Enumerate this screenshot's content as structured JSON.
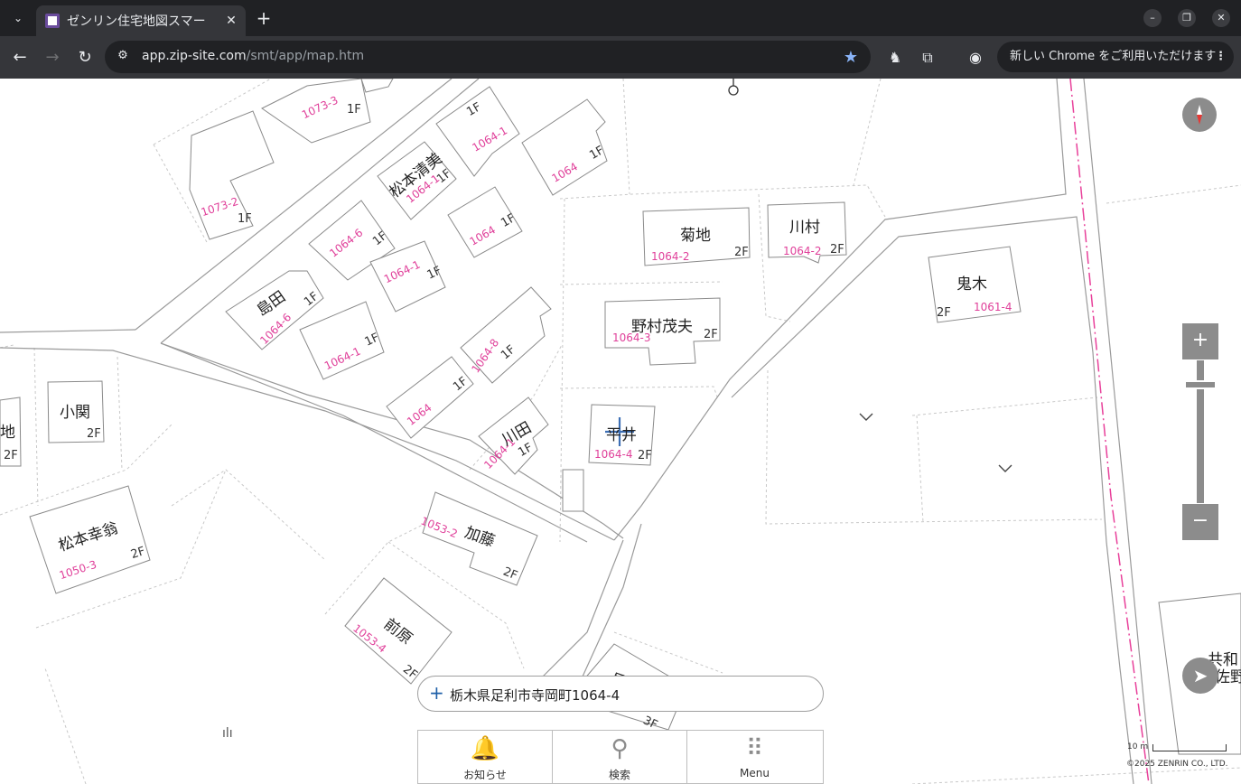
{
  "browser": {
    "tab_title": "ゼンリン住宅地図スマー",
    "url_host": "app.zip-site.com",
    "url_path": "/smt/app/map.htm",
    "update_label": "新しい Chrome をご利用いただけます"
  },
  "map": {
    "address": "栃木県足利市寺岡町1064-4",
    "labels": [
      {
        "text": "1073-3",
        "kind": "num"
      },
      {
        "text": "1F",
        "kind": "fl"
      },
      {
        "text": "1073-2",
        "kind": "num"
      },
      {
        "text": "1F",
        "kind": "fl"
      },
      {
        "text": "1F",
        "kind": "fl"
      },
      {
        "text": "1064-1",
        "kind": "num"
      },
      {
        "text": "1064",
        "kind": "num"
      },
      {
        "text": "1F",
        "kind": "fl"
      },
      {
        "text": "松本清美",
        "kind": "name"
      },
      {
        "text": "1064-1",
        "kind": "num"
      },
      {
        "text": "1F",
        "kind": "fl"
      },
      {
        "text": "1064",
        "kind": "num"
      },
      {
        "text": "1F",
        "kind": "fl"
      },
      {
        "text": "1064-6",
        "kind": "num"
      },
      {
        "text": "1F",
        "kind": "fl"
      },
      {
        "text": "1064-1",
        "kind": "num"
      },
      {
        "text": "1F",
        "kind": "fl"
      },
      {
        "text": "島田",
        "kind": "name"
      },
      {
        "text": "1064-6",
        "kind": "num"
      },
      {
        "text": "1F",
        "kind": "fl"
      },
      {
        "text": "1064-1",
        "kind": "num"
      },
      {
        "text": "1F",
        "kind": "fl"
      },
      {
        "text": "1064-8",
        "kind": "num"
      },
      {
        "text": "1F",
        "kind": "fl"
      },
      {
        "text": "1064",
        "kind": "num"
      },
      {
        "text": "1F",
        "kind": "fl"
      },
      {
        "text": "川田",
        "kind": "name"
      },
      {
        "text": "1064-1",
        "kind": "num"
      },
      {
        "text": "1F",
        "kind": "fl"
      },
      {
        "text": "菊地",
        "kind": "name"
      },
      {
        "text": "1064-2",
        "kind": "num"
      },
      {
        "text": "2F",
        "kind": "fl"
      },
      {
        "text": "川村",
        "kind": "name"
      },
      {
        "text": "1064-2",
        "kind": "num"
      },
      {
        "text": "2F",
        "kind": "fl"
      },
      {
        "text": "野村茂夫",
        "kind": "name"
      },
      {
        "text": "1064-3",
        "kind": "num"
      },
      {
        "text": "2F",
        "kind": "fl"
      },
      {
        "text": "平井",
        "kind": "name"
      },
      {
        "text": "1064-4",
        "kind": "num"
      },
      {
        "text": "2F",
        "kind": "fl"
      },
      {
        "text": "鬼木",
        "kind": "name"
      },
      {
        "text": "2F",
        "kind": "fl"
      },
      {
        "text": "1061-4",
        "kind": "num"
      },
      {
        "text": "小関",
        "kind": "name"
      },
      {
        "text": "2F",
        "kind": "fl"
      },
      {
        "text": "地",
        "kind": "name"
      },
      {
        "text": "2F",
        "kind": "fl"
      },
      {
        "text": "松本幸翁",
        "kind": "name"
      },
      {
        "text": "1050-3",
        "kind": "num"
      },
      {
        "text": "2F",
        "kind": "fl"
      },
      {
        "text": "加藤",
        "kind": "name"
      },
      {
        "text": "1053-2",
        "kind": "num"
      },
      {
        "text": "2F",
        "kind": "fl"
      },
      {
        "text": "前原",
        "kind": "name"
      },
      {
        "text": "1053-4",
        "kind": "num"
      },
      {
        "text": "2F",
        "kind": "fl"
      },
      {
        "text": "岳",
        "kind": "name"
      },
      {
        "text": "3F",
        "kind": "fl"
      },
      {
        "text": "共和",
        "kind": "name"
      },
      {
        "text": "佐野",
        "kind": "name"
      }
    ]
  },
  "nav": [
    {
      "label": "お知らせ",
      "icon": "bell-icon"
    },
    {
      "label": "検索",
      "icon": "search-icon"
    },
    {
      "label": "Menu",
      "icon": "grid-icon"
    }
  ],
  "scale_label": "10 m",
  "copyright": "©2025 ZENRIN CO., LTD."
}
